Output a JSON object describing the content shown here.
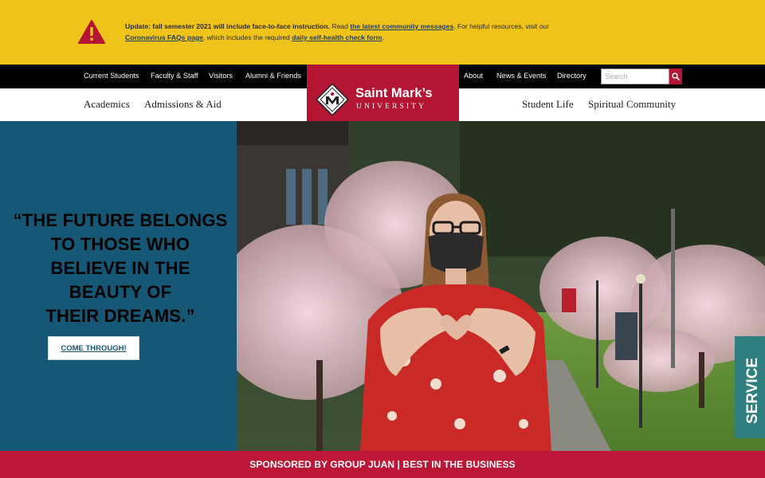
{
  "alert": {
    "icon": "warning-triangle-icon",
    "bold_lead": "Update: fall semester 2021 will include face-to-face instruction.",
    "text_1": " Read ",
    "link_1": "the latest community messages",
    "text_2": ". For helpful resources, visit our ",
    "link_2": "Coronavirus FAQs page",
    "text_3": ", which includes the required ",
    "link_3": "daily self-health check form",
    "text_4": "."
  },
  "utility_nav": {
    "left": [
      "Current Students",
      "Faculty & Staff",
      "Visitors",
      "Alumni & Friends"
    ],
    "right": [
      "About",
      "News & Events",
      "Directory"
    ],
    "search_placeholder": "Search",
    "search_icon": "magnifier-icon"
  },
  "logo": {
    "name": "Saint Mark’s",
    "subtitle": "UNIVERSITY",
    "emblem": "diamond-crest-icon"
  },
  "main_nav": {
    "left": [
      "Academics",
      "Admissions & Aid"
    ],
    "right": [
      "Student Life",
      "Spiritual Community"
    ]
  },
  "hero": {
    "quote_lines": [
      "“THE FUTURE BELONGS",
      "TO THOSE WHO",
      "BELIEVE IN THE",
      "BEAUTY OF",
      "THEIR DREAMS.”"
    ],
    "cta_label": "COME THROUGH!",
    "banner_text": "SERVICE"
  },
  "sponsor": {
    "text": "SPONSORED BY GROUP JUAN | BEST IN THE BUSINESS"
  },
  "colors": {
    "alert_bg": "#efc31a",
    "utility_bg": "#000000",
    "brand_red": "#bd1737",
    "hero_blue": "#155774"
  }
}
